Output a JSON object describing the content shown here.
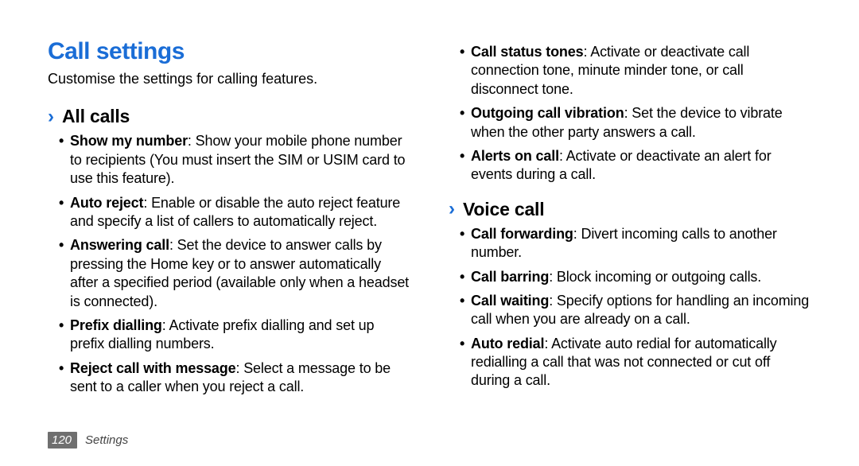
{
  "title": "Call settings",
  "intro": "Customise the settings for calling features.",
  "left": {
    "subhead": "All calls",
    "items": [
      {
        "label": "Show my number",
        "text": ": Show your mobile phone number to recipients (You must insert the SIM or USIM card to use this feature)."
      },
      {
        "label": "Auto reject",
        "text": ": Enable or disable the auto reject feature and specify a list of callers to automatically reject."
      },
      {
        "label": "Answering call",
        "text": ": Set the device to answer calls by pressing the Home key or to answer automatically after a specified period (available only when a headset is connected)."
      },
      {
        "label": "Prefix dialling",
        "text": ": Activate prefix dialling and set up prefix dialling numbers."
      },
      {
        "label": "Reject call with message",
        "text": ": Select a message to be sent to a caller when you reject a call."
      }
    ]
  },
  "right_top": {
    "items": [
      {
        "label": "Call status tones",
        "text": ": Activate or deactivate call connection tone, minute minder tone, or call disconnect tone."
      },
      {
        "label": "Outgoing call vibration",
        "text": ": Set the device to vibrate when the other party answers a call."
      },
      {
        "label": "Alerts on call",
        "text": ": Activate or deactivate an alert for events during a call."
      }
    ]
  },
  "right": {
    "subhead": "Voice call",
    "items": [
      {
        "label": "Call forwarding",
        "text": ": Divert incoming calls to another number."
      },
      {
        "label": "Call barring",
        "text": ": Block incoming or outgoing calls."
      },
      {
        "label": "Call waiting",
        "text": ": Specify options for handling an incoming call when you are already on a call."
      },
      {
        "label": "Auto redial",
        "text": ": Activate auto redial for automatically redialling a call that was not connected or cut off during a call."
      }
    ]
  },
  "footer": {
    "page": "120",
    "section": "Settings"
  }
}
